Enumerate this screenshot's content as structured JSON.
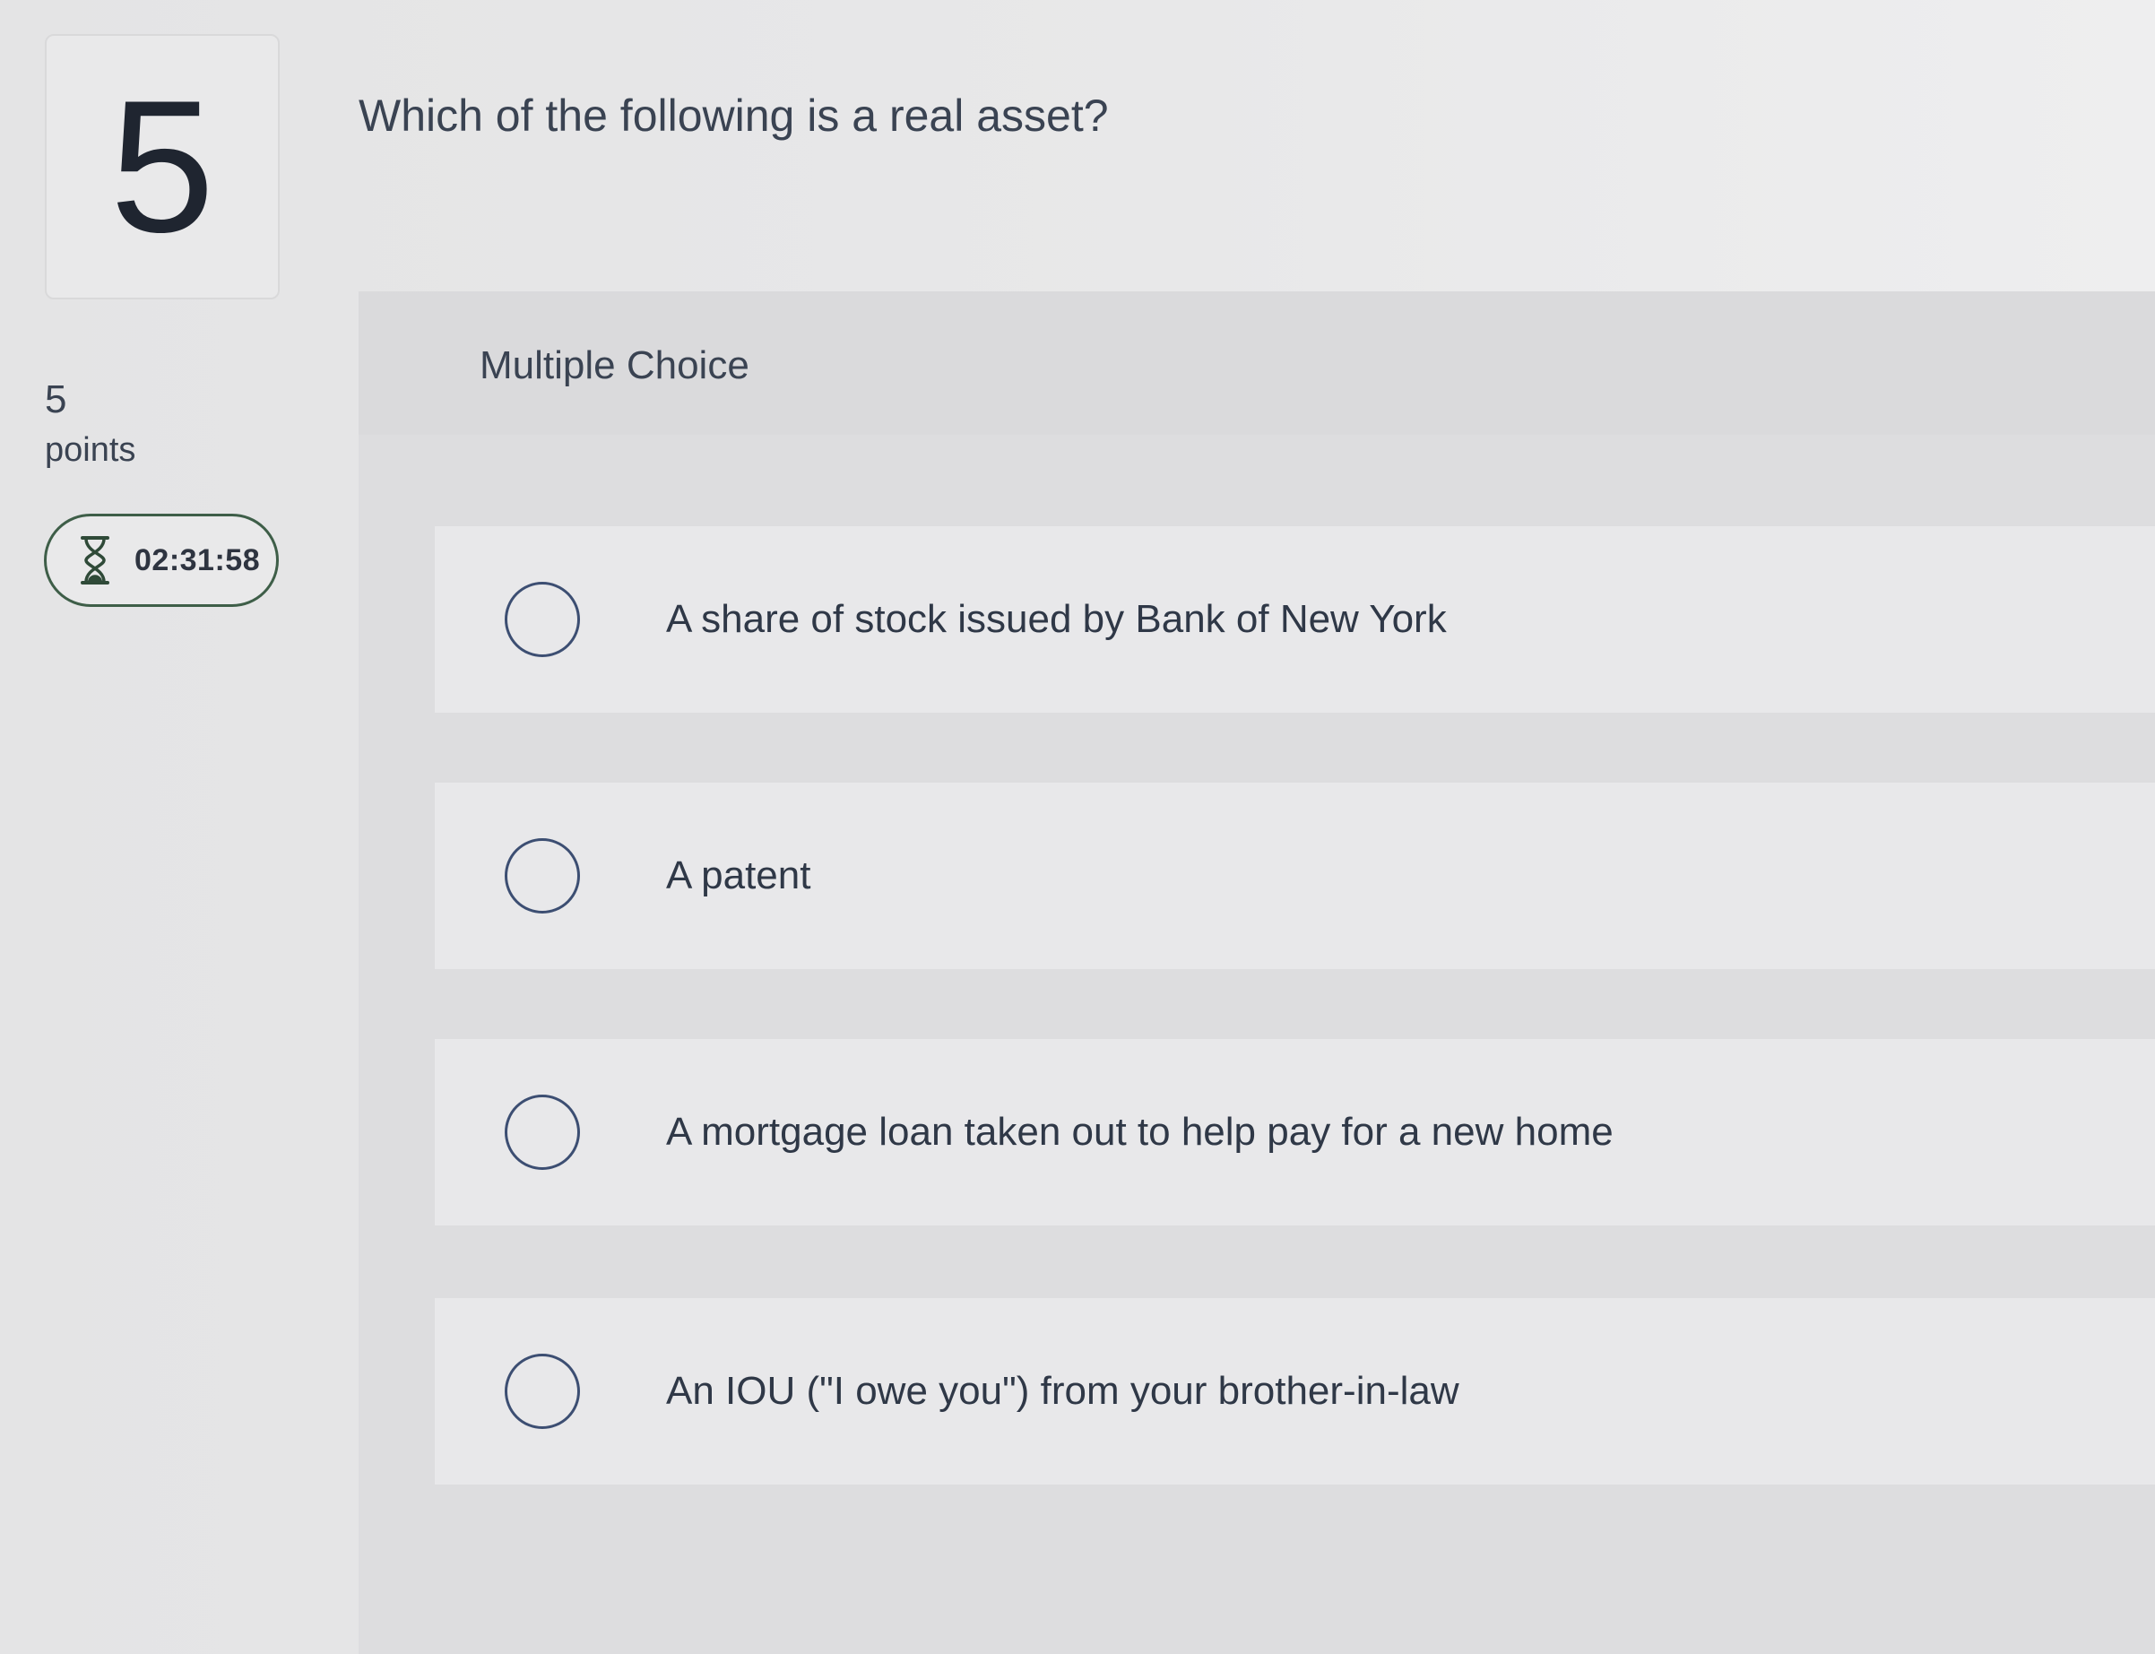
{
  "question": {
    "number": "5",
    "text": "Which of the following is a real asset?",
    "points_value": "5",
    "points_label": "points",
    "timer": "02:31:58",
    "type": "Multiple Choice",
    "options": [
      {
        "label": "A share of stock issued by Bank of New York"
      },
      {
        "label": "A patent"
      },
      {
        "label": "A mortgage loan taken out to help pay for a new home"
      },
      {
        "label": "An IOU (\"I owe you\") from your brother-in-law"
      }
    ]
  },
  "icons": {
    "timer": "hourglass-icon",
    "option_selector": "radio-circle-icon"
  },
  "colors": {
    "timer_border": "#3e5e48",
    "radio_border": "#3c4e72"
  }
}
